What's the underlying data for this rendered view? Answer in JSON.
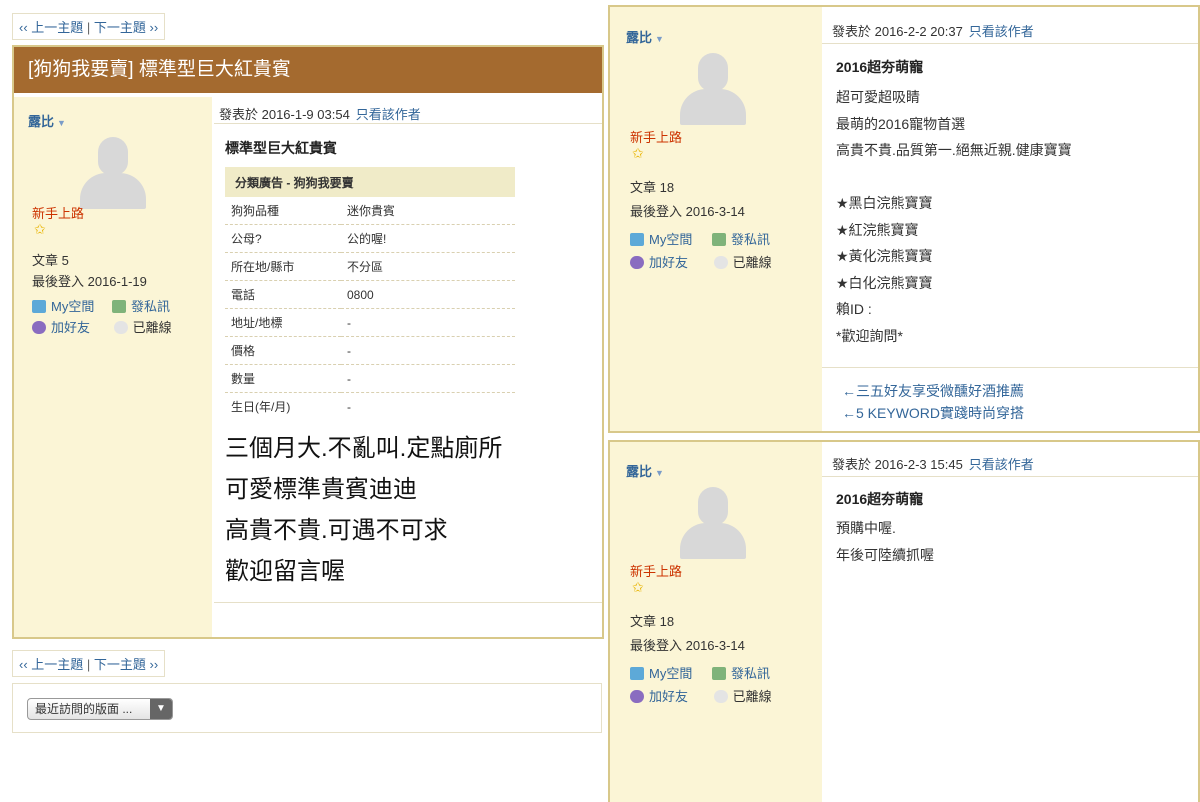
{
  "nav": {
    "prev": "‹‹ 上一主題",
    "sep": "|",
    "next": "下一主題 ››"
  },
  "thread_title": "[狗狗我要賣] 標準型巨大紅貴賓",
  "user_panel": {
    "name": "露比",
    "rank": "新手上路",
    "links": {
      "space": "My空間",
      "message": "發私訊",
      "friend": "加好友",
      "offline": "已離線"
    }
  },
  "post1": {
    "user": {
      "posts": "文章 5",
      "last_login": "最後登入 2016-1-19"
    },
    "meta": {
      "posted": "發表於 2016-1-9 03:54",
      "only_author": "只看該作者"
    },
    "title": "標準型巨大紅貴賓",
    "ad_header": "分類廣告 - 狗狗我要賣",
    "ad_rows": [
      {
        "label": "狗狗品種",
        "value": "迷你貴賓"
      },
      {
        "label": "公母?",
        "value": "公的喔!"
      },
      {
        "label": "所在地/縣市",
        "value": "不分區"
      },
      {
        "label": "電話",
        "value": "0800"
      },
      {
        "label": "地址/地標",
        "value": "-"
      },
      {
        "label": "價格",
        "value": "-"
      },
      {
        "label": "數量",
        "value": "-"
      },
      {
        "label": "生日(年/月)",
        "value": "-"
      }
    ],
    "body": [
      "三個月大.不亂叫.定點廁所",
      "可愛標準貴賓迪迪",
      "高貴不貴.可遇不可求",
      "歡迎留言喔"
    ]
  },
  "forum_select": "最近訪問的版面 ...",
  "post2": {
    "user": {
      "posts": "文章 18",
      "last_login": "最後登入 2016-3-14"
    },
    "meta": {
      "posted": "發表於 2016-2-2 20:37",
      "only_author": "只看該作者"
    },
    "title": "2016超夯萌寵",
    "body": [
      "超可愛超吸睛",
      "最萌的2016寵物首選",
      "高貴不貴.品質第一.絕無近親.健康寶寶",
      "",
      "★黑白浣熊寶寶",
      "★紅浣熊寶寶",
      "★黃化浣熊寶寶",
      "★白化浣熊寶寶",
      "賴ID :",
      "*歡迎詢問*"
    ],
    "signature": [
      "←三五好友享受微醺好酒推薦",
      "←5 KEYWORD實踐時尚穿搭"
    ]
  },
  "post3": {
    "user": {
      "posts": "文章 18",
      "last_login": "最後登入 2016-3-14"
    },
    "meta": {
      "posted": "發表於 2016-2-3 15:45",
      "only_author": "只看該作者"
    },
    "title": "2016超夯萌寵",
    "body": [
      "預購中喔.",
      "年後可陸續抓喔"
    ]
  }
}
